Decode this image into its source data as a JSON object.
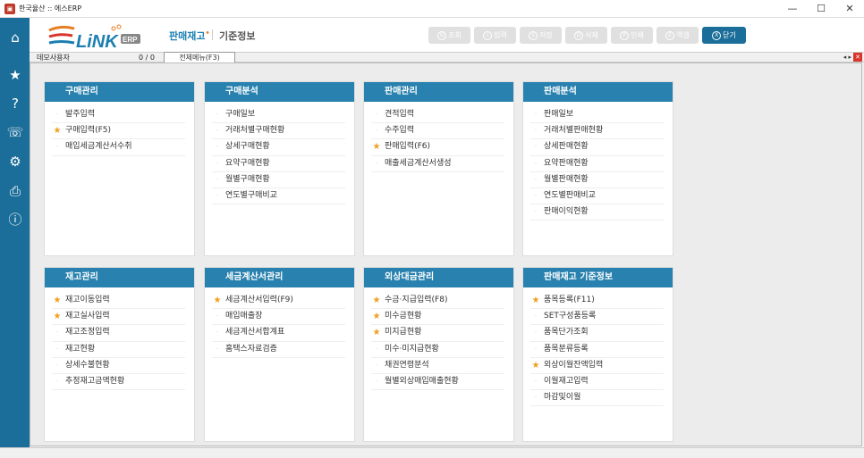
{
  "window": {
    "title": "한국율산 :: 에스ERP",
    "controls": [
      "—",
      "☐",
      "✕"
    ]
  },
  "sidebar": {
    "items": [
      {
        "icon": "home-icon",
        "glyph": "⌂"
      },
      {
        "icon": "star-icon",
        "glyph": "★"
      },
      {
        "icon": "help-icon",
        "glyph": "?"
      },
      {
        "icon": "headset-icon",
        "glyph": "☏"
      },
      {
        "icon": "gear-icon",
        "glyph": "⚙"
      },
      {
        "icon": "printer-icon",
        "glyph": "⎙"
      },
      {
        "icon": "info-icon",
        "glyph": "ⓘ"
      }
    ]
  },
  "header": {
    "logo_text": "LiNK",
    "logo_badge": "ERP",
    "menu1": "판매재고",
    "menu2": "기준정보"
  },
  "toolbar": {
    "buttons": [
      {
        "key": "Q",
        "label": "조회"
      },
      {
        "key": "I",
        "label": "입력"
      },
      {
        "key": "S",
        "label": "저장"
      },
      {
        "key": "D",
        "label": "삭제"
      },
      {
        "key": "P",
        "label": "인쇄"
      },
      {
        "key": "E",
        "label": "엑셀"
      },
      {
        "key": "X",
        "label": "닫기"
      }
    ]
  },
  "tabbar": {
    "user": "데모사용자",
    "count": "0 / 0",
    "tab": "전체메뉴(F3)",
    "nav": "◂ ▸",
    "close": "✕"
  },
  "panels": [
    {
      "title": "구매관리",
      "items": [
        {
          "label": "발주입력",
          "fav": false
        },
        {
          "label": "구매입력(F5)",
          "fav": true
        },
        {
          "label": "매입세금계산서수취",
          "fav": false
        }
      ]
    },
    {
      "title": "구매분석",
      "items": [
        {
          "label": "구매일보",
          "fav": false
        },
        {
          "label": "거래처별구매현황",
          "fav": false
        },
        {
          "label": "상세구매현황",
          "fav": false
        },
        {
          "label": "요약구매현황",
          "fav": false
        },
        {
          "label": "월별구매현황",
          "fav": false
        },
        {
          "label": "연도별구매비교",
          "fav": false
        }
      ]
    },
    {
      "title": "판매관리",
      "items": [
        {
          "label": "견적입력",
          "fav": false
        },
        {
          "label": "수주입력",
          "fav": false
        },
        {
          "label": "판매입력(F6)",
          "fav": true
        },
        {
          "label": "매출세금계산서생성",
          "fav": false
        }
      ]
    },
    {
      "title": "판매분석",
      "items": [
        {
          "label": "판매일보",
          "fav": false
        },
        {
          "label": "거래처별판매현황",
          "fav": false
        },
        {
          "label": "상세판매현황",
          "fav": false
        },
        {
          "label": "요약판매현황",
          "fav": false
        },
        {
          "label": "월별판매현황",
          "fav": false
        },
        {
          "label": "연도별판매비교",
          "fav": false
        },
        {
          "label": "판매이익현황",
          "fav": false
        }
      ]
    },
    {
      "title": "재고관리",
      "items": [
        {
          "label": "재고이동입력",
          "fav": true
        },
        {
          "label": "재고실사입력",
          "fav": true
        },
        {
          "label": "재고조정입력",
          "fav": false
        },
        {
          "label": "재고현황",
          "fav": false
        },
        {
          "label": "상세수불현황",
          "fav": false
        },
        {
          "label": "추정재고금액현황",
          "fav": false
        }
      ]
    },
    {
      "title": "세금계산서관리",
      "items": [
        {
          "label": "세금계산서입력(F9)",
          "fav": true
        },
        {
          "label": "매입매출장",
          "fav": false
        },
        {
          "label": "세금계산서합계표",
          "fav": false
        },
        {
          "label": "홈택스자료검증",
          "fav": false
        }
      ]
    },
    {
      "title": "외상대금관리",
      "items": [
        {
          "label": "수금·지급입력(F8)",
          "fav": true
        },
        {
          "label": "미수금현황",
          "fav": true
        },
        {
          "label": "미지급현황",
          "fav": true
        },
        {
          "label": "미수·미지급현황",
          "fav": false
        },
        {
          "label": "채권연령분석",
          "fav": false
        },
        {
          "label": "월별외상매입매출현황",
          "fav": false
        }
      ]
    },
    {
      "title": "판매재고 기준정보",
      "items": [
        {
          "label": "품목등록(F11)",
          "fav": true
        },
        {
          "label": "SET구성품등록",
          "fav": false
        },
        {
          "label": "품목단가조회",
          "fav": false
        },
        {
          "label": "품목분류등록",
          "fav": false
        },
        {
          "label": "외상이월잔액입력",
          "fav": true
        },
        {
          "label": "이월재고입력",
          "fav": false
        },
        {
          "label": "마감및이월",
          "fav": false
        }
      ]
    }
  ],
  "colors": {
    "sidebar": "#1b6e99",
    "panel_header": "#2881ae",
    "star": "#f0a020",
    "close_button": "#1b6e99"
  }
}
